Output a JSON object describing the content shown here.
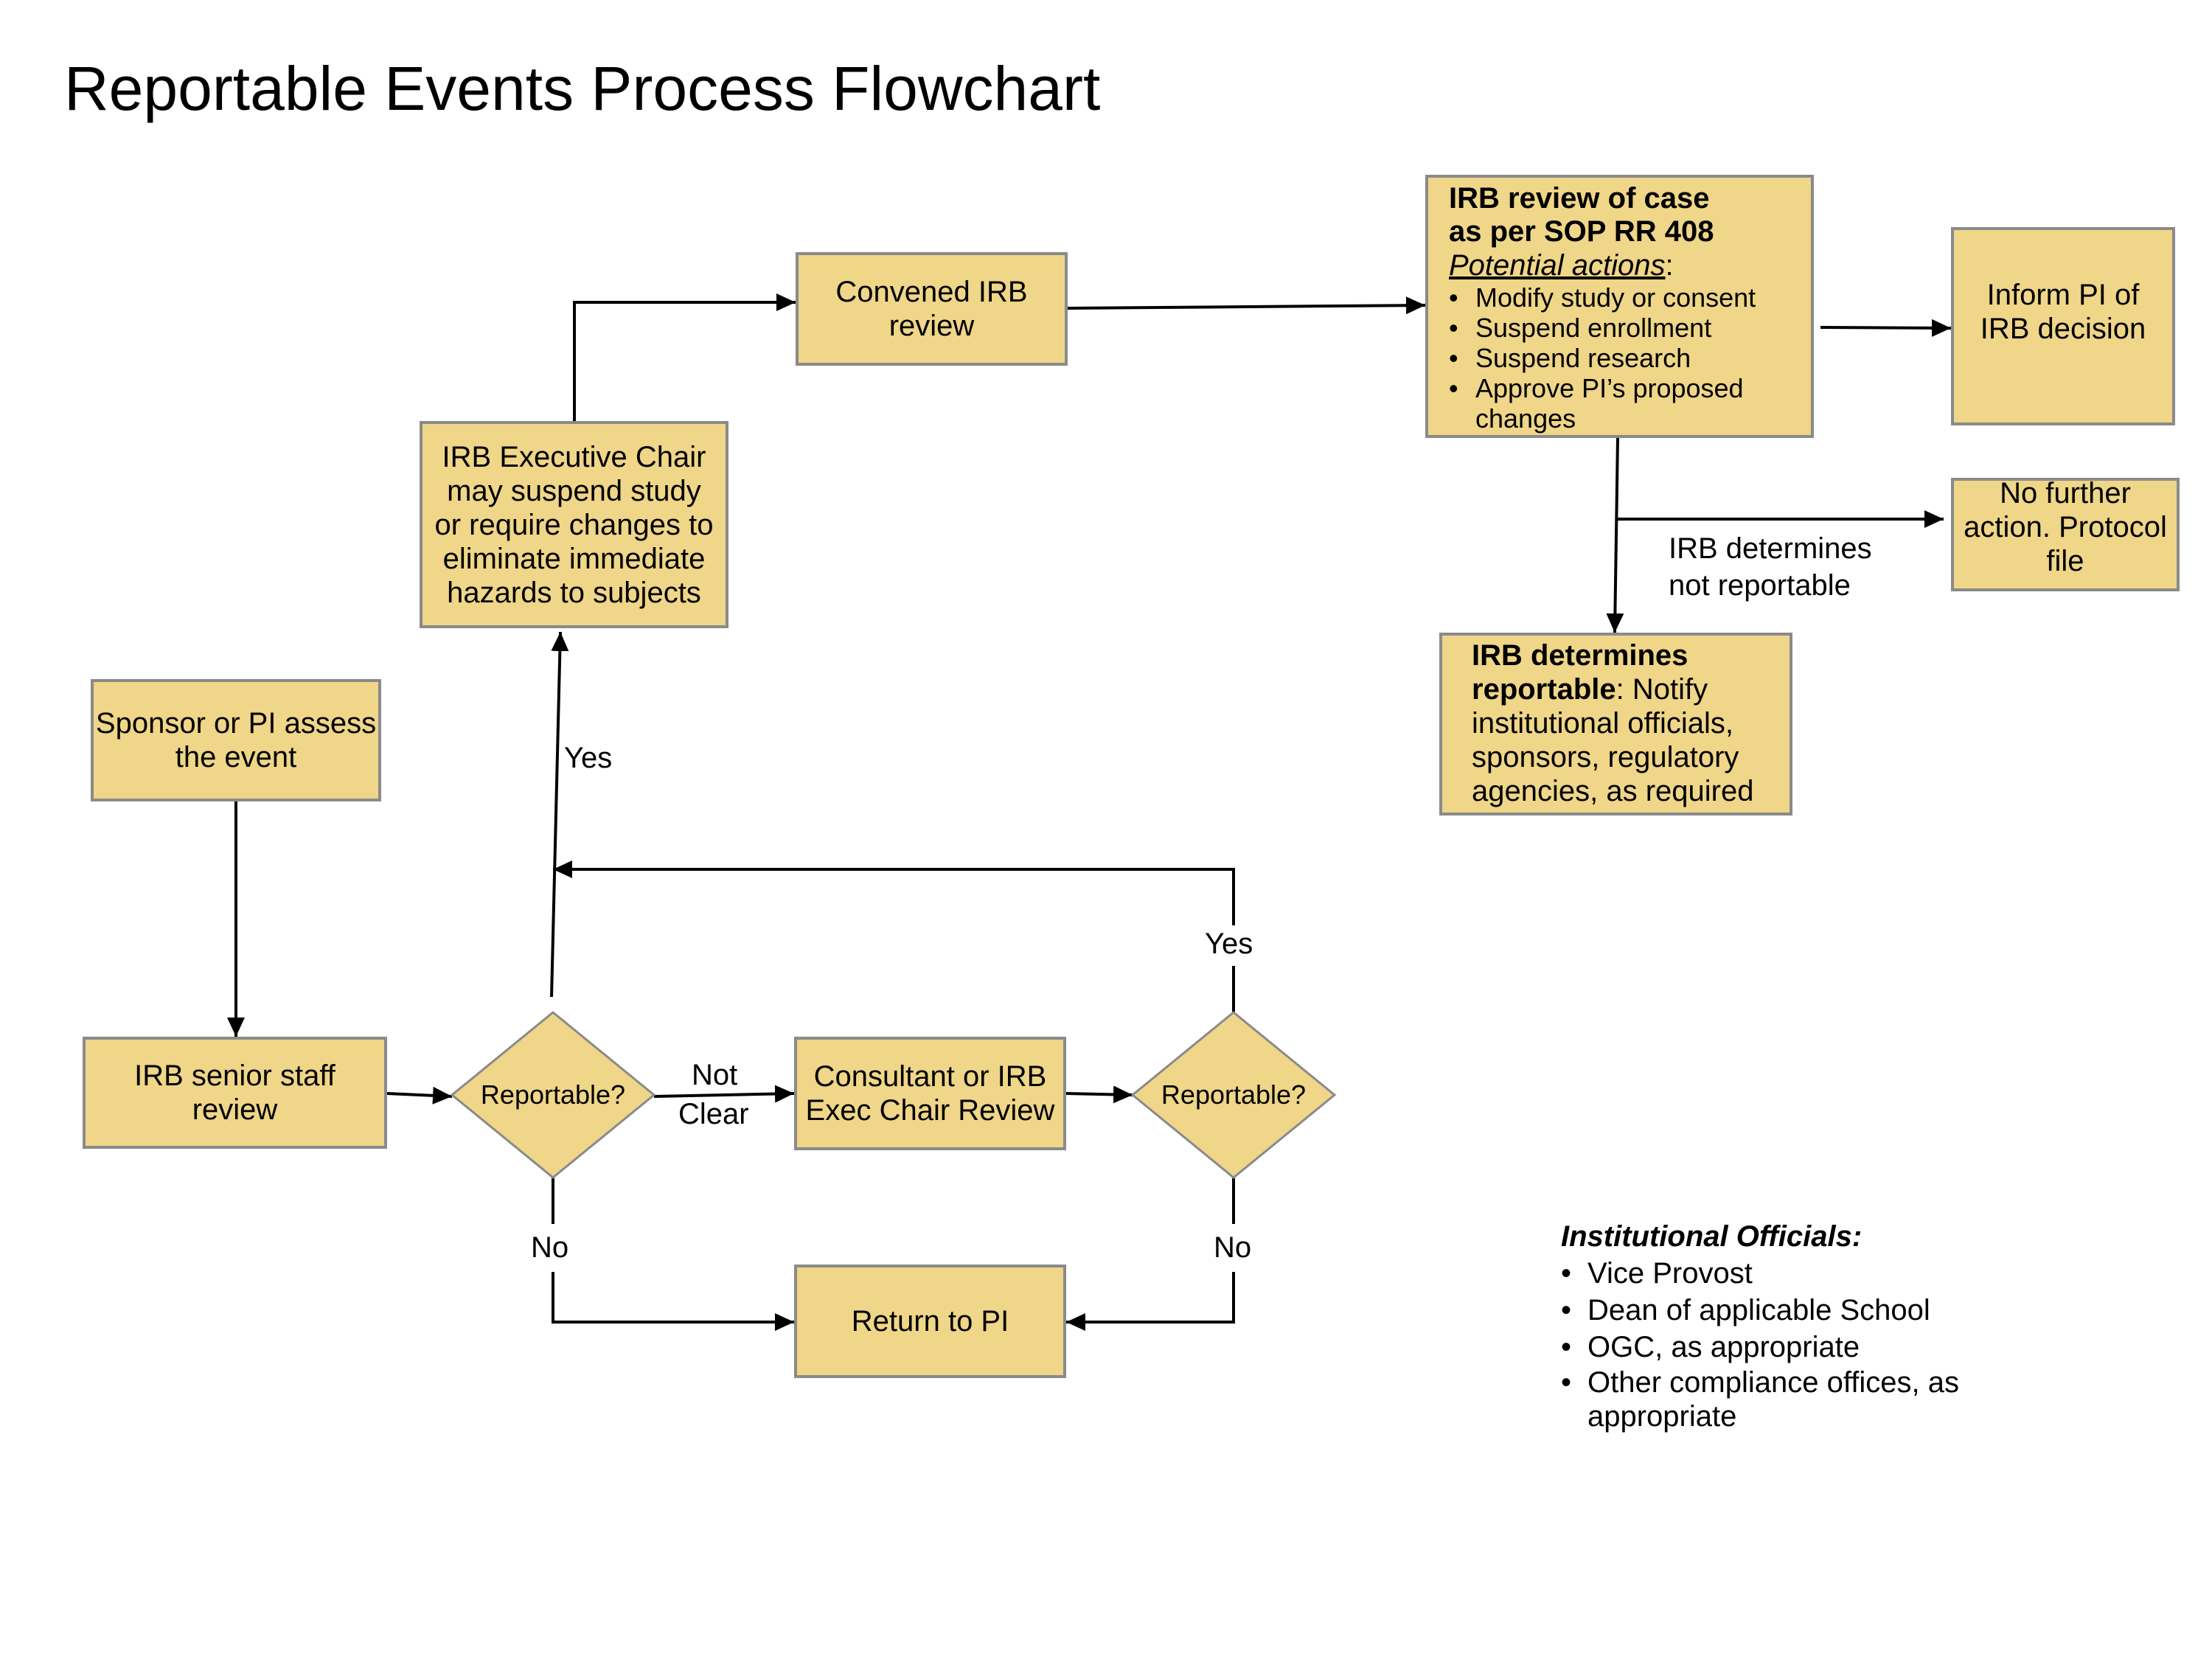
{
  "title": "Reportable Events Process Flowchart",
  "colors": {
    "box_fill": "#EFD688",
    "box_border": "#8a8a8a",
    "line": "#000000"
  },
  "nodes": {
    "sponsor": "Sponsor or PI assess the event",
    "senior_staff": "IRB senior staff review",
    "decision1": "Reportable?",
    "consultant": "Consultant or IRB Exec Chair Review",
    "decision2": "Reportable?",
    "return_pi": "Return to PI",
    "exec_chair": "IRB Executive Chair may suspend study or require changes to eliminate immediate hazards to subjects",
    "convened": "Convened IRB review",
    "irb_review": {
      "title1": "IRB review of case",
      "title2": "as per SOP RR 408",
      "subtitle": "Potential actions",
      "actions": [
        "Modify study or consent",
        "Suspend enrollment",
        "Suspend research",
        "Approve PI’s proposed changes"
      ]
    },
    "inform_pi": "Inform PI of IRB decision",
    "no_further": "No further action. Protocol file",
    "reportable": {
      "bold": "IRB determines reportable",
      "rest": ": Notify institutional officials, sponsors, regulatory agencies, as required"
    }
  },
  "edge_labels": {
    "yes1": "Yes",
    "yes2": "Yes",
    "no1": "No",
    "no2": "No",
    "not_clear1": "Not",
    "not_clear2": "Clear",
    "not_reportable1": "IRB determines",
    "not_reportable2": "not reportable"
  },
  "institutional": {
    "heading": "Institutional Officials:",
    "items": [
      "Vice Provost",
      "Dean of applicable School",
      "OGC, as appropriate",
      "Other compliance offices, as appropriate"
    ]
  }
}
